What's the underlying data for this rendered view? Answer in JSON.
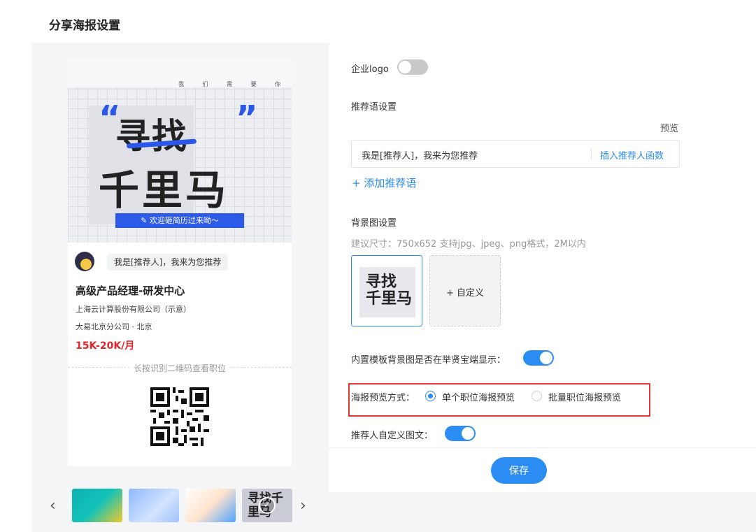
{
  "page": {
    "title": "分享海报设置"
  },
  "poster": {
    "we_need": "我 们 需 要 你",
    "headline_line1": "寻找",
    "headline_line2": "千里马",
    "quote_open": "“",
    "quote_close": "”",
    "banner": "✎ 欢迎砸简历过来呦～",
    "recommender_text": "我是[推荐人]，我来为您推荐",
    "job_title": "高级产品经理-研发中心",
    "company": "上海云计算股份有限公司（示意）",
    "location": "大易北京分公司 · 北京",
    "salary": "15K-20K/月",
    "qr_hint": "长按识别二维码查看职位"
  },
  "carousel": {
    "prev": "‹",
    "next": "›",
    "selected_thumb_text": "寻找千里马",
    "selected_check": "✓"
  },
  "settings": {
    "logo_label": "企业logo",
    "logo_enabled": false,
    "recommend_label": "推荐语设置",
    "preview_label": "预览",
    "recommend_value": "我是[推荐人]，我来为您推荐",
    "insert_function": "插入推荐人函数",
    "add_recommend": "+ 添加推荐语",
    "bg_label": "背景图设置",
    "bg_hint": "建议尺寸：750x652 支持jpg、jpeg、png格式，2M以内",
    "bg_preset_text1": "寻找",
    "bg_preset_text2": "千里马",
    "bg_custom": "+ 自定义",
    "builtin_label": "内置模板背景图是否在举贤宝端显示：",
    "builtin_enabled": true,
    "preview_mode_label": "海报预览方式：",
    "preview_mode_options": [
      "单个职位海报预览",
      "批量职位海报预览"
    ],
    "preview_mode_selected": "单个职位海报预览",
    "custom_graphic_label": "推荐人自定义图文：",
    "custom_graphic_enabled": true,
    "save_button": "保存"
  },
  "colors": {
    "accent": "#2b8cf4",
    "poster_blue": "#2b58e8",
    "salary_red": "#e3262c",
    "highlight_red": "#e03a3a"
  }
}
